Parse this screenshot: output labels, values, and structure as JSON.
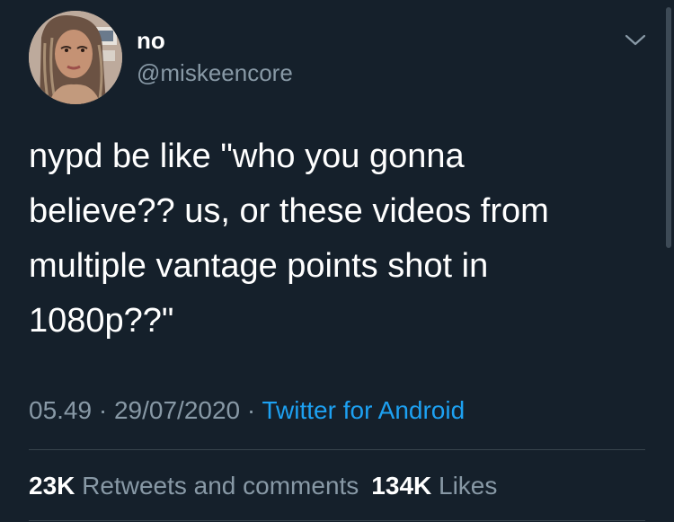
{
  "author": {
    "display_name": "no",
    "handle": "@miskeencore"
  },
  "icons": {
    "menu": "chevron-down-icon"
  },
  "tweet": {
    "text": "nypd be like \"who you gonna\nbelieve?? us, or these videos from\nmultiple vantage points shot in\n1080p??\""
  },
  "meta": {
    "time": "05.49",
    "separator": "·",
    "date": "29/07/2020",
    "source": "Twitter for Android"
  },
  "stats": {
    "retweets_count": "23K",
    "retweets_label": "Retweets and comments",
    "likes_count": "134K",
    "likes_label": "Likes"
  },
  "colors": {
    "background": "#15202b",
    "text_primary": "#ffffff",
    "text_secondary": "#8899a6",
    "link": "#1da1f2",
    "divider": "#38444d"
  }
}
